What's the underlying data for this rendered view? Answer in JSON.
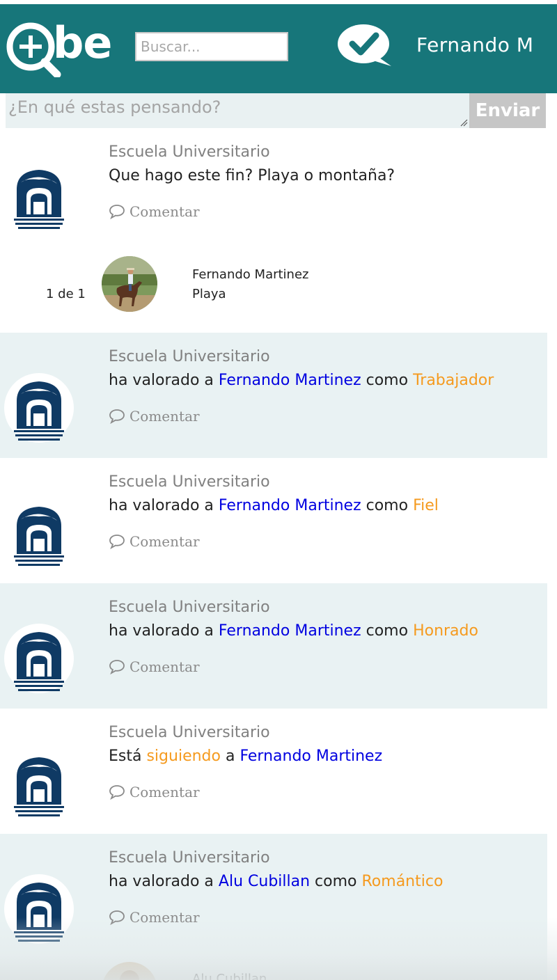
{
  "header": {
    "logo_text": "be",
    "search_placeholder": "Buscar...",
    "user_name": "Fernando M",
    "icons": {
      "logo": "plus-q-logo-icon",
      "messages": "check-bubble-icon"
    }
  },
  "composer": {
    "placeholder": "¿En qué estas pensando?",
    "send_label": "Enviar"
  },
  "comment_label": "Comentar",
  "colors": {
    "header": "#17767a",
    "alt_row": "#e9f2f3",
    "link_blue": "#0000e0",
    "link_orange": "#f59a1e"
  },
  "posts": [
    {
      "author": "Escuela Universitario",
      "text": "Que hago este fin? Playa o montaña?",
      "answers": {
        "count": "1 de 1",
        "name": "Fernando Martinez",
        "text": "Playa"
      }
    },
    {
      "author": "Escuela Universitario",
      "pre": "ha valorado a ",
      "subject": "Fernando Martinez",
      "mid": " como ",
      "value": "Trabajador"
    },
    {
      "author": "Escuela Universitario",
      "pre": "ha valorado a ",
      "subject": "Fernando Martinez",
      "mid": " como ",
      "value": "Fiel"
    },
    {
      "author": "Escuela Universitario",
      "pre": "ha valorado a ",
      "subject": "Fernando Martinez",
      "mid": " como ",
      "value": "Honrado"
    },
    {
      "author": "Escuela Universitario",
      "pre": "Está ",
      "action": "siguiendo",
      "mid": " a ",
      "subject": "Fernando Martinez"
    },
    {
      "author": "Escuela Universitario",
      "pre": "ha valorado a ",
      "subject": "Alu Cubillan",
      "mid": " como ",
      "value": "Romántico",
      "answer_name_partial": "Alu Cubillan"
    }
  ]
}
